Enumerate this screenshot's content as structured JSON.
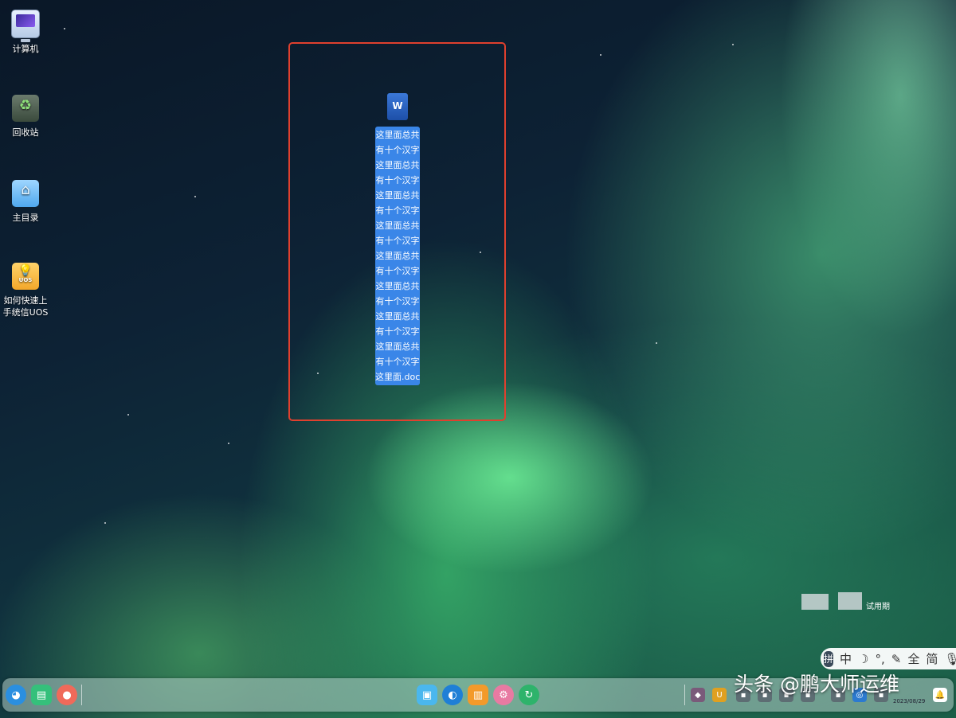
{
  "desktop": {
    "icons": [
      {
        "label": "计算机",
        "icon": "computer-icon"
      },
      {
        "label": "回收站",
        "icon": "trash-icon"
      },
      {
        "label": "主目录",
        "icon": "home-folder-icon"
      },
      {
        "label_line1": "如何快速上",
        "label_line2": "手统信UOS",
        "badge": "UOS",
        "icon": "guide-icon"
      }
    ],
    "file": {
      "icon": "word-document-icon",
      "icon_glyph": "W",
      "name_lines": [
        "这里面总共",
        "有十个汉字",
        "这里面总共",
        "有十个汉字",
        "这里面总共",
        "有十个汉字",
        "这里面总共",
        "有十个汉字",
        "这里面总共",
        "有十个汉字",
        "这里面总共",
        "有十个汉字",
        "这里面总共",
        "有十个汉字",
        "这里面总共",
        "有十个汉字",
        "这里面.doc"
      ]
    }
  },
  "system": {
    "trial_text": "试用期"
  },
  "ime": {
    "items": [
      "拼",
      "中",
      "☽",
      "°,",
      "✎",
      "全",
      "简",
      "🎙"
    ]
  },
  "dock": {
    "date": "2023/08/29",
    "left_apps": [
      "launcher-icon",
      "multitask-icon",
      "screen-record-icon"
    ],
    "center_apps": [
      "app-store-icon",
      "browser-icon",
      "file-manager-icon",
      "settings-icon",
      "update-icon"
    ]
  },
  "watermark": "头条 @鹏大师运维"
}
